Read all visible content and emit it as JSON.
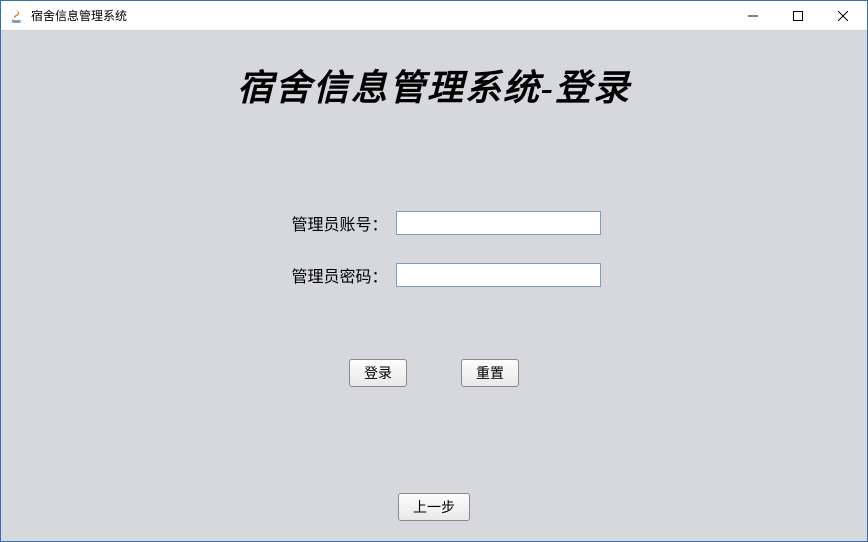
{
  "window": {
    "title": "宿舍信息管理系统"
  },
  "page": {
    "heading": "宿舍信息管理系统-登录"
  },
  "form": {
    "username_label": "管理员账号：",
    "username_value": "",
    "password_label": "管理员密码：",
    "password_value": ""
  },
  "buttons": {
    "login": "登录",
    "reset": "重置",
    "back": "上一步"
  }
}
